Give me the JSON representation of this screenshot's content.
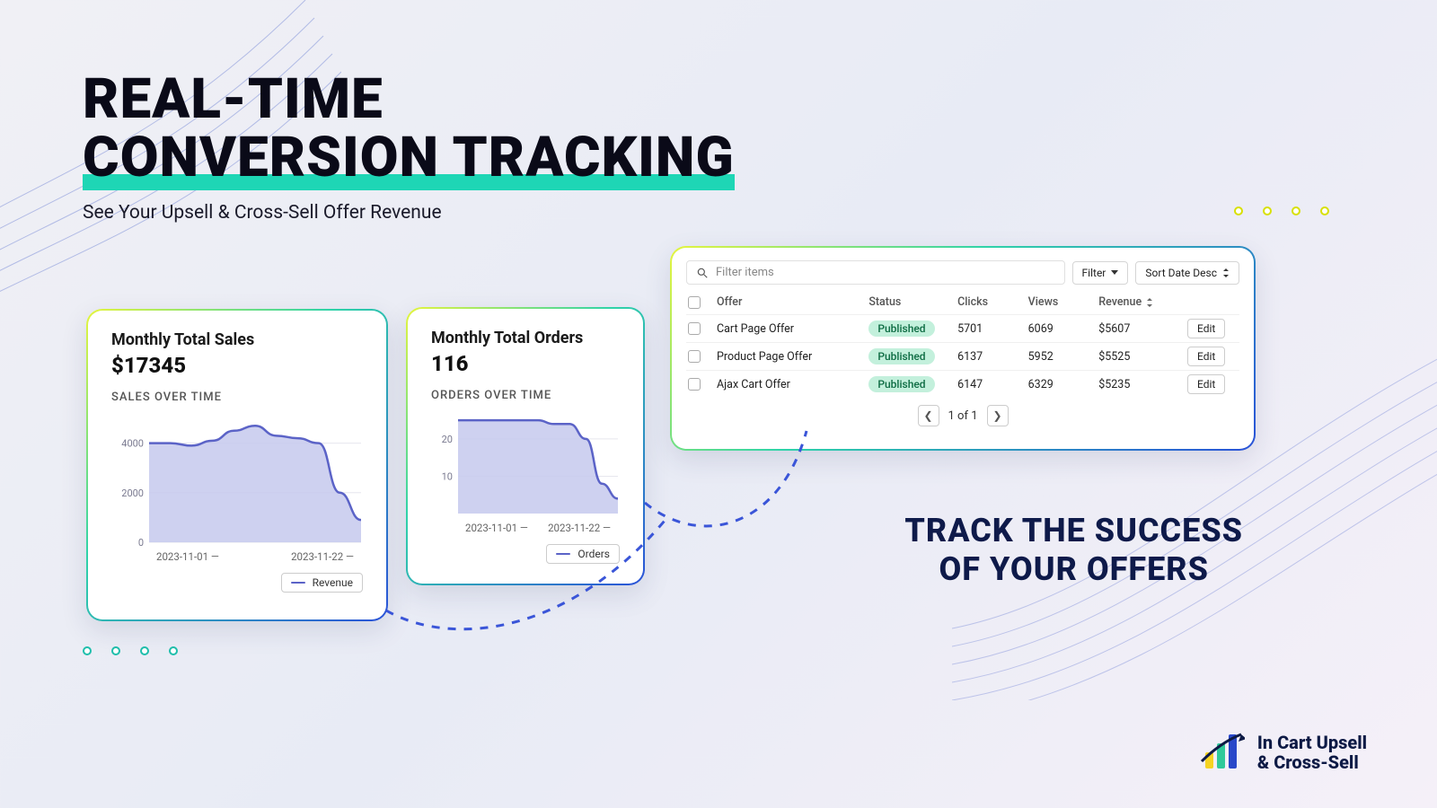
{
  "headline": {
    "line1": "REAL-TIME",
    "line2": "CONVERSION TRACKING"
  },
  "subhead": "See Your Upsell & Cross-Sell Offer Revenue",
  "tagline": {
    "l1": "TRACK THE SUCCESS",
    "l2": "OF YOUR OFFERS"
  },
  "brand": {
    "line1": "In Cart Upsell",
    "line2": "& Cross-Sell"
  },
  "sales_card": {
    "title": "Monthly Total Sales",
    "value": "$17345",
    "sub": "SALES OVER TIME",
    "legend": "Revenue",
    "chart_data": {
      "type": "area",
      "title": "Sales Over Time",
      "ylabel": "Revenue",
      "y_ticks": [
        0,
        2000,
        4000
      ],
      "x_ticks": [
        "2023-11-01",
        "2023-11-22"
      ],
      "x": [
        "2023-11-01",
        "2023-11-04",
        "2023-11-07",
        "2023-11-10",
        "2023-11-13",
        "2023-11-16",
        "2023-11-19",
        "2023-11-22",
        "2023-11-25",
        "2023-11-28",
        "2023-11-30"
      ],
      "values": [
        4000,
        4000,
        3900,
        4100,
        4500,
        4700,
        4300,
        4200,
        4000,
        2000,
        900
      ],
      "ylim": [
        0,
        5000
      ]
    }
  },
  "orders_card": {
    "title": "Monthly Total Orders",
    "value": "116",
    "sub": "ORDERS OVER TIME",
    "legend": "Orders",
    "chart_data": {
      "type": "area",
      "title": "Orders Over Time",
      "ylabel": "Orders",
      "y_ticks": [
        10,
        20
      ],
      "x_ticks": [
        "2023-11-01",
        "2023-11-22"
      ],
      "x": [
        "2023-11-01",
        "2023-11-04",
        "2023-11-07",
        "2023-11-10",
        "2023-11-13",
        "2023-11-16",
        "2023-11-19",
        "2023-11-22",
        "2023-11-25",
        "2023-11-28",
        "2023-11-30"
      ],
      "values": [
        25,
        25,
        25,
        25,
        25,
        25,
        24,
        24,
        20,
        8,
        4
      ],
      "ylim": [
        0,
        26
      ]
    }
  },
  "table": {
    "filter_placeholder": "Filter items",
    "filter_btn": "Filter",
    "sort_btn": "Sort Date Desc",
    "headers": {
      "c1": "Offer",
      "c2": "Status",
      "c3": "Clicks",
      "c4": "Views",
      "c5": "Revenue"
    },
    "rows": [
      {
        "offer": "Cart Page Offer",
        "status": "Published",
        "clicks": "5701",
        "views": "6069",
        "revenue": "$5607",
        "action": "Edit"
      },
      {
        "offer": "Product Page Offer",
        "status": "Published",
        "clicks": "6137",
        "views": "5952",
        "revenue": "$5525",
        "action": "Edit"
      },
      {
        "offer": "Ajax Cart Offer",
        "status": "Published",
        "clicks": "6147",
        "views": "6329",
        "revenue": "$5235",
        "action": "Edit"
      }
    ],
    "pager": "1 of 1"
  },
  "colors": {
    "accent": "#1ed6b5",
    "chart_stroke": "#5b63c7",
    "chart_fill": "#c6c9ed"
  }
}
